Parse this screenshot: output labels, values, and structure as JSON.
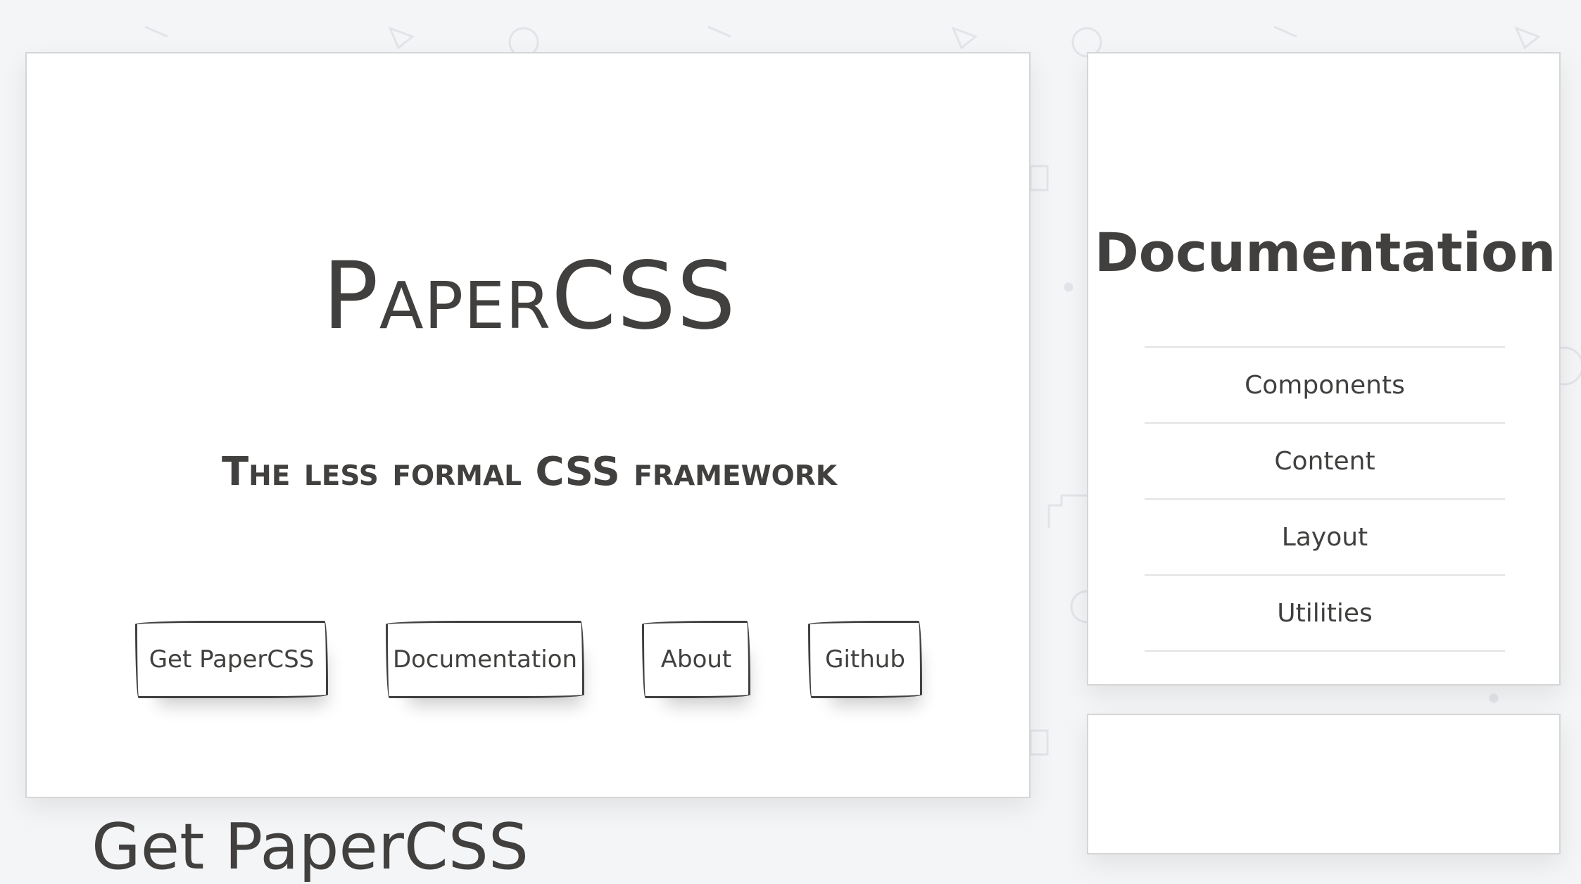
{
  "hero": {
    "title": "PaperCSS",
    "subtitle": "The less formal CSS framework"
  },
  "buttons": {
    "get": "Get PaperCSS",
    "docs": "Documentation",
    "about": "About",
    "github": "Github"
  },
  "main": {
    "next_heading": "Get PaperCSS"
  },
  "sidebar": {
    "title": "Documentation",
    "items": [
      {
        "label": "Components"
      },
      {
        "label": "Content"
      },
      {
        "label": "Layout"
      },
      {
        "label": "Utilities"
      }
    ]
  },
  "colors": {
    "text": "#41403e",
    "background": "#f4f5f7",
    "card": "#ffffff"
  }
}
